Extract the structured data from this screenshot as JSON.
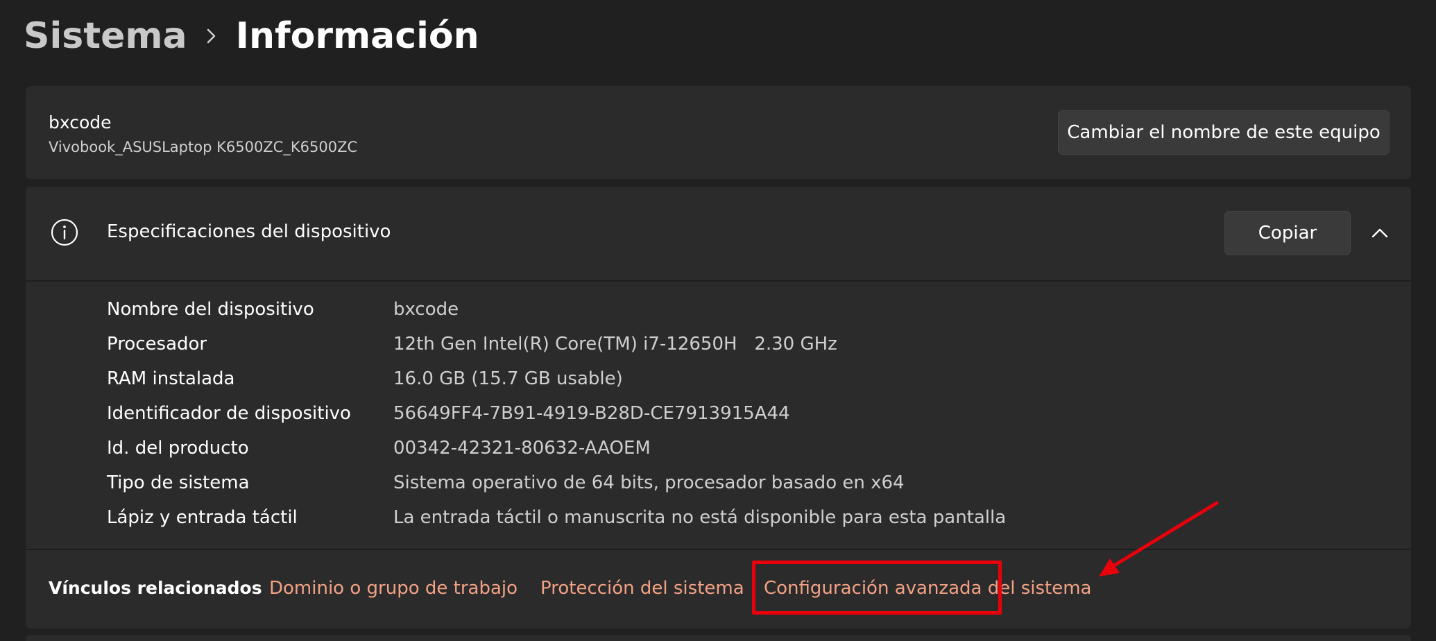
{
  "breadcrumb": {
    "parent": "Sistema",
    "current": "Información"
  },
  "device": {
    "name": "bxcode",
    "model": "Vivobook_ASUSLaptop K6500ZC_K6500ZC",
    "rename_button": "Cambiar el nombre de este equipo"
  },
  "specs": {
    "title": "Especificaciones del dispositivo",
    "copy_button": "Copiar",
    "rows": [
      {
        "label": "Nombre del dispositivo",
        "value": "bxcode"
      },
      {
        "label": "Procesador",
        "value": "12th Gen Intel(R) Core(TM) i7-12650H   2.30 GHz"
      },
      {
        "label": "RAM instalada",
        "value": "16.0 GB (15.7 GB usable)"
      },
      {
        "label": "Identificador de dispositivo",
        "value": "56649FF4-7B91-4919-B28D-CE7913915A44"
      },
      {
        "label": "Id. del producto",
        "value": "00342-42321-80632-AAOEM"
      },
      {
        "label": "Tipo de sistema",
        "value": "Sistema operativo de 64 bits, procesador basado en x64"
      },
      {
        "label": "Lápiz y entrada táctil",
        "value": "La entrada táctil o manuscrita no está disponible para esta pantalla"
      }
    ]
  },
  "related_links": {
    "label": "Vínculos relacionados",
    "links": [
      "Dominio o grupo de trabajo",
      "Protección del sistema",
      "Configuración avanzada del sistema"
    ]
  },
  "colors": {
    "background": "#202020",
    "card": "#2b2b2b",
    "link": "#f3a285",
    "annotation": "#e8000b"
  },
  "icons": {
    "breadcrumb_separator": "chevron-right-icon",
    "specs": "info-icon",
    "collapse": "chevron-up-icon",
    "annotation": "red-arrow-icon"
  }
}
